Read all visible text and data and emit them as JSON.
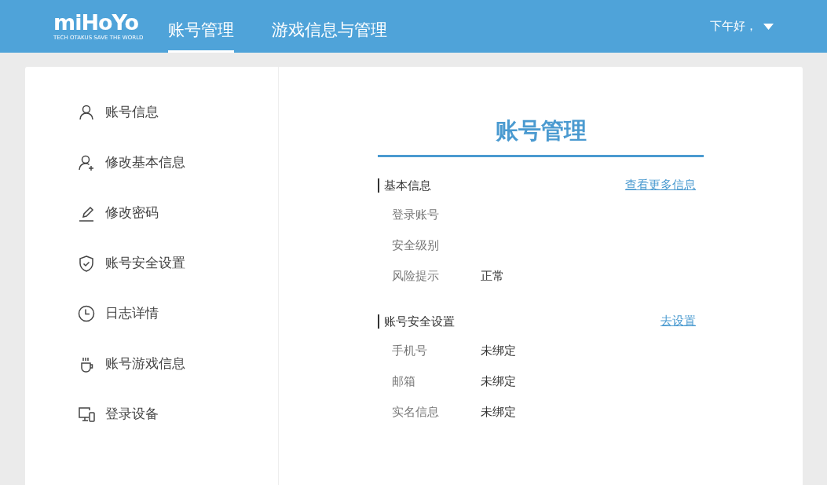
{
  "header": {
    "logo": {
      "name": "miHoYo",
      "tagline": "TECH OTAKUS SAVE THE WORLD"
    },
    "nav": [
      {
        "label": "账号管理",
        "selected": true
      },
      {
        "label": "游戏信息与管理",
        "selected": false
      }
    ],
    "greeting": "下午好，"
  },
  "sidebar": {
    "items": [
      {
        "label": "账号信息",
        "kind": "user"
      },
      {
        "label": "修改基本信息",
        "kind": "useradd"
      },
      {
        "label": "修改密码",
        "kind": "pencil"
      },
      {
        "label": "账号安全设置",
        "kind": "shield"
      },
      {
        "label": "日志详情",
        "kind": "clock"
      },
      {
        "label": "账号游戏信息",
        "kind": "cup"
      },
      {
        "label": "登录设备",
        "kind": "devices"
      }
    ]
  },
  "main": {
    "title": "账号管理",
    "sections": [
      {
        "title": "基本信息",
        "link": "查看更多信息",
        "rows": [
          {
            "label": "登录账号"
          },
          {
            "label": "安全级别"
          },
          {
            "label": "风险提示",
            "value": "正常"
          }
        ]
      },
      {
        "title": "账号安全设置",
        "link": "去设置",
        "rows": [
          {
            "label": "手机号",
            "value": "未绑定"
          },
          {
            "label": "邮箱",
            "value": "未绑定"
          },
          {
            "label": "实名信息",
            "value": "未绑定"
          }
        ]
      }
    ]
  }
}
